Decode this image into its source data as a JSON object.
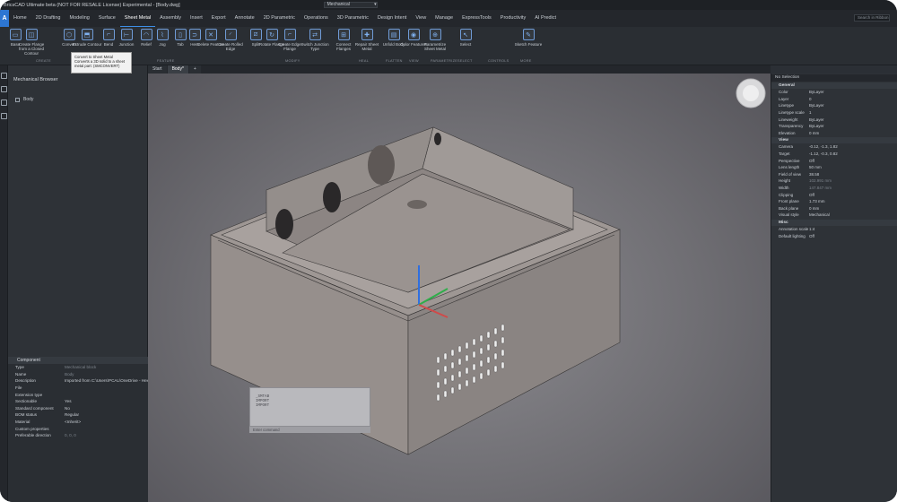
{
  "window": {
    "title": "BricsCAD Ultimate beta (NOT FOR RESALE License) Experimental - [Body.dwg]",
    "workspace": "Mechanical"
  },
  "menu": {
    "app_icon": "A",
    "tabs": [
      "Home",
      "2D Drafting",
      "Modeling",
      "Surface",
      "Sheet Metal",
      "Assembly",
      "Insert",
      "Export",
      "Annotate",
      "2D Parametric",
      "Operations",
      "3D Parametric",
      "Design Intent",
      "View",
      "Manage",
      "ExpressTools",
      "Productivity",
      "AI Predict"
    ],
    "active": "Sheet Metal",
    "search_placeholder": "Search in Ribbon"
  },
  "ribbon": {
    "tools": [
      {
        "label": "Base",
        "icon": "base-flange-icon"
      },
      {
        "label": "Create Flange from a Closed Contour",
        "icon": "flange-contour-icon"
      },
      {
        "label": "Convert",
        "icon": "convert-icon"
      },
      {
        "label": "Extrude Contour",
        "icon": "extrude-contour-icon"
      },
      {
        "label": "Bend",
        "icon": "bend-icon"
      },
      {
        "label": "Junction",
        "icon": "junction-icon"
      },
      {
        "label": "Relief",
        "icon": "relief-icon"
      },
      {
        "label": "Jog",
        "icon": "jog-icon"
      },
      {
        "label": "Tab",
        "icon": "tab-icon"
      },
      {
        "label": "Hem",
        "icon": "hem-icon"
      },
      {
        "label": "Delete Feature",
        "icon": "delete-feature-icon"
      },
      {
        "label": "Create Rolled Edge",
        "icon": "rolled-edge-icon"
      },
      {
        "label": "Split",
        "icon": "split-icon"
      },
      {
        "label": "Rotate Flange",
        "icon": "rotate-flange-icon"
      },
      {
        "label": "Create Edge Flange",
        "icon": "edge-flange-icon"
      },
      {
        "label": "Switch Junction Type",
        "icon": "switch-junction-icon"
      },
      {
        "label": "Connect Flanges",
        "icon": "connect-flanges-icon"
      },
      {
        "label": "Repair Sheet Metal",
        "icon": "repair-icon"
      },
      {
        "label": "Unfold Body",
        "icon": "unfold-icon"
      },
      {
        "label": "Color Features",
        "icon": "color-features-icon"
      },
      {
        "label": "Parametrize Sheet Metal",
        "icon": "parametrize-icon"
      },
      {
        "label": "Select",
        "icon": "select-icon"
      },
      {
        "label": "Sketch Feature",
        "icon": "sketch-feature-icon"
      }
    ],
    "groups": [
      "CREATE",
      "FEATURE",
      "MODIFY",
      "HEAL",
      "FLATTEN",
      "VIEW",
      "PARAMETRIZE",
      "SELECT",
      "CONTROLS",
      "MORE"
    ],
    "tooltip": {
      "title": "Convert to Sheet Metal",
      "desc": "Converts a 3D solid to a sheet metal part: (SMCONVERT)"
    }
  },
  "browser": {
    "title": "Mechanical Browser",
    "root": "Body"
  },
  "component": {
    "title": "Component",
    "rows": [
      {
        "k": "Type",
        "v": "Mechanical block"
      },
      {
        "k": "Name",
        "v": "Body"
      },
      {
        "k": "Description",
        "v": "Imported from C:\\Users\\PCAL\\OneDrive - Hex"
      },
      {
        "k": "File",
        "v": ""
      },
      {
        "k": "Extension type",
        "v": ""
      },
      {
        "k": "Sectionable",
        "v": "Yes"
      },
      {
        "k": "Standard component",
        "v": "No"
      },
      {
        "k": "BOM status",
        "v": "Regular"
      },
      {
        "k": "Material",
        "v": "<Inherit>"
      },
      {
        "k": "Custom properties",
        "v": ""
      },
      {
        "k": "Preferable direction",
        "v": "0, 0, 0"
      }
    ]
  },
  "doc_tabs": [
    "Start",
    "Body*",
    "+"
  ],
  "command": {
    "history": [
      "_SMTAB",
      "IMPORT",
      "IMPORT"
    ],
    "prompt": "Enter command"
  },
  "properties": {
    "selection": "No Selection",
    "sections": [
      {
        "name": "General",
        "rows": [
          {
            "k": "Color",
            "v": "ByLayer"
          },
          {
            "k": "Layer",
            "v": "0"
          },
          {
            "k": "Linetype",
            "v": "ByLayer"
          },
          {
            "k": "Linetype scale",
            "v": "1"
          },
          {
            "k": "Lineweight",
            "v": "ByLayer"
          },
          {
            "k": "Transparency",
            "v": "ByLayer"
          },
          {
            "k": "Elevation",
            "v": "0 mm"
          }
        ]
      },
      {
        "name": "View",
        "rows": [
          {
            "k": "Camera",
            "v": "-0.12, -1.3, 1.82"
          },
          {
            "k": "Target",
            "v": "-1.12, -0.3, 0.82"
          },
          {
            "k": "Perspective",
            "v": "Off"
          },
          {
            "k": "Lens length",
            "v": "50 mm"
          },
          {
            "k": "Field of view",
            "v": "38.58"
          },
          {
            "k": "Height",
            "v": "102.991 mm"
          },
          {
            "k": "Width",
            "v": "147.847 mm"
          },
          {
            "k": "Clipping",
            "v": "Off"
          },
          {
            "k": "Front plane",
            "v": "1.73 mm"
          },
          {
            "k": "Back plane",
            "v": "0 mm"
          },
          {
            "k": "Visual style",
            "v": "Mechanical"
          }
        ]
      },
      {
        "name": "Misc",
        "rows": [
          {
            "k": "Annotation scale",
            "v": "1:4"
          },
          {
            "k": "Default lighting",
            "v": "Off"
          }
        ]
      }
    ]
  }
}
